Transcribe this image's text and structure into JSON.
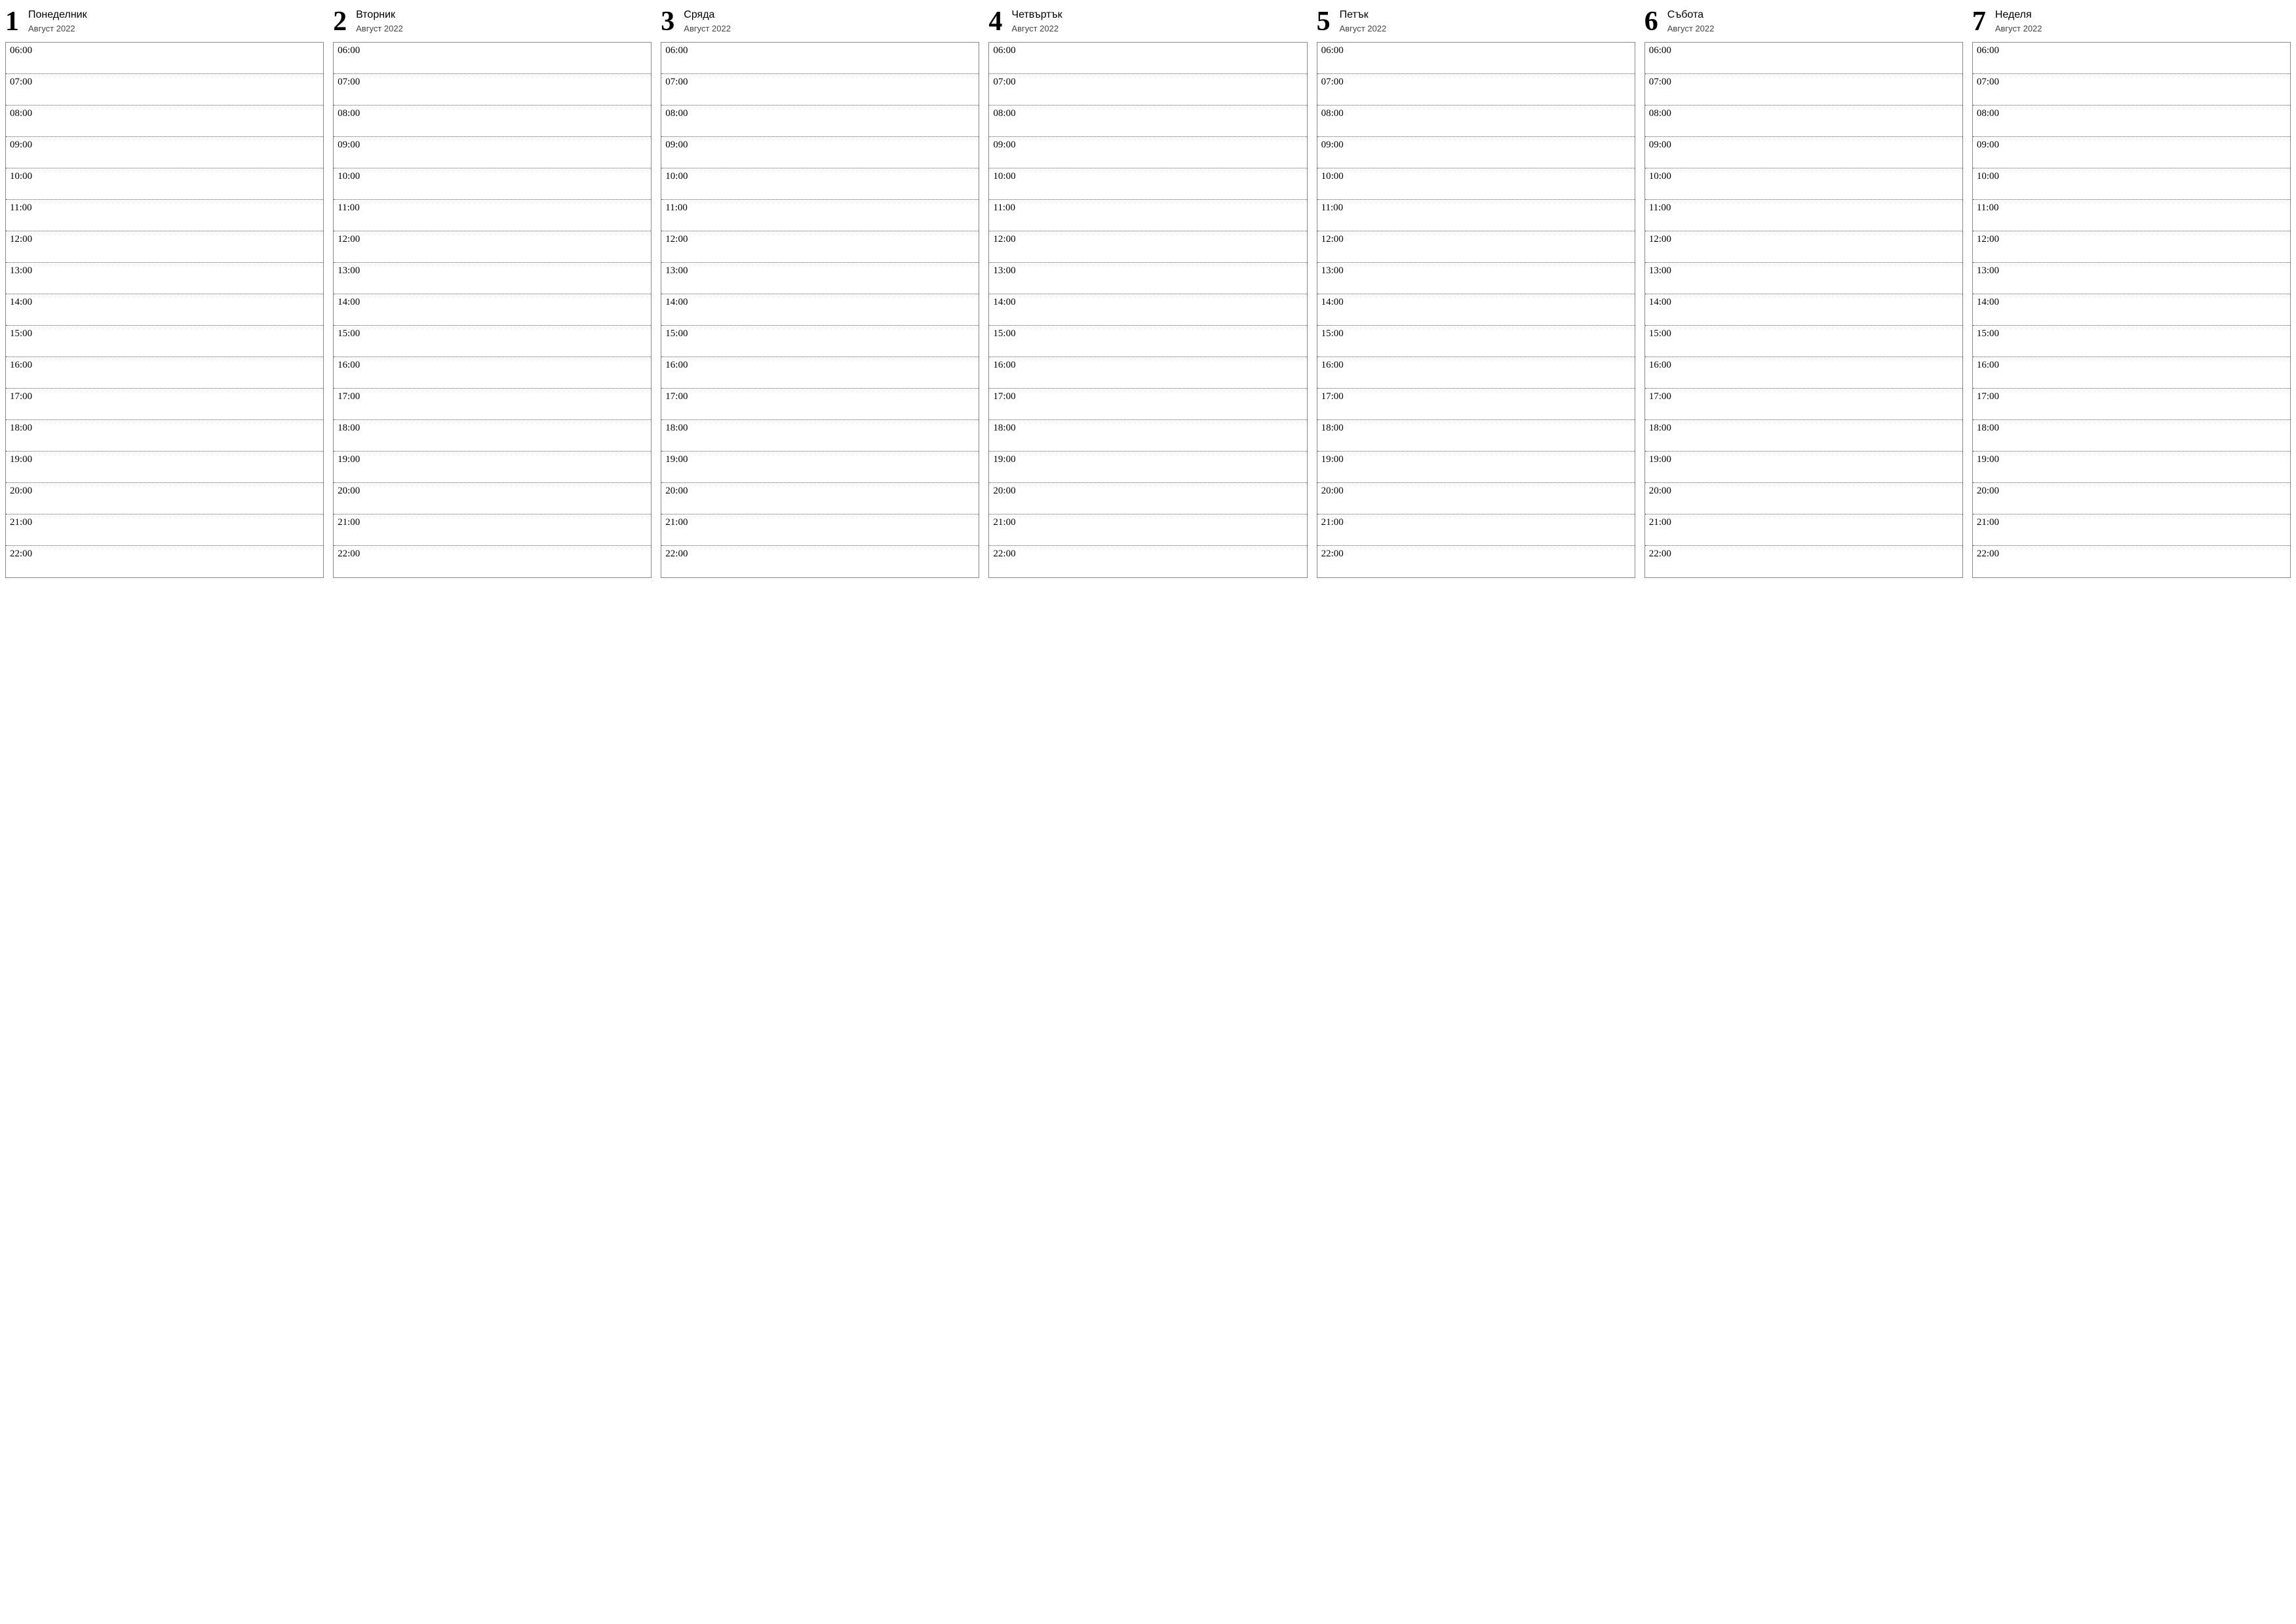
{
  "calendar": {
    "month_label": "Август 2022",
    "days": [
      {
        "number": "1",
        "weekday": "Понеделник"
      },
      {
        "number": "2",
        "weekday": "Вторник"
      },
      {
        "number": "3",
        "weekday": "Сряда"
      },
      {
        "number": "4",
        "weekday": "Четвъртък"
      },
      {
        "number": "5",
        "weekday": "Петък"
      },
      {
        "number": "6",
        "weekday": "Събота"
      },
      {
        "number": "7",
        "weekday": "Неделя"
      }
    ],
    "hours": [
      "06:00",
      "07:00",
      "08:00",
      "09:00",
      "10:00",
      "11:00",
      "12:00",
      "13:00",
      "14:00",
      "15:00",
      "16:00",
      "17:00",
      "18:00",
      "19:00",
      "20:00",
      "21:00",
      "22:00"
    ]
  }
}
